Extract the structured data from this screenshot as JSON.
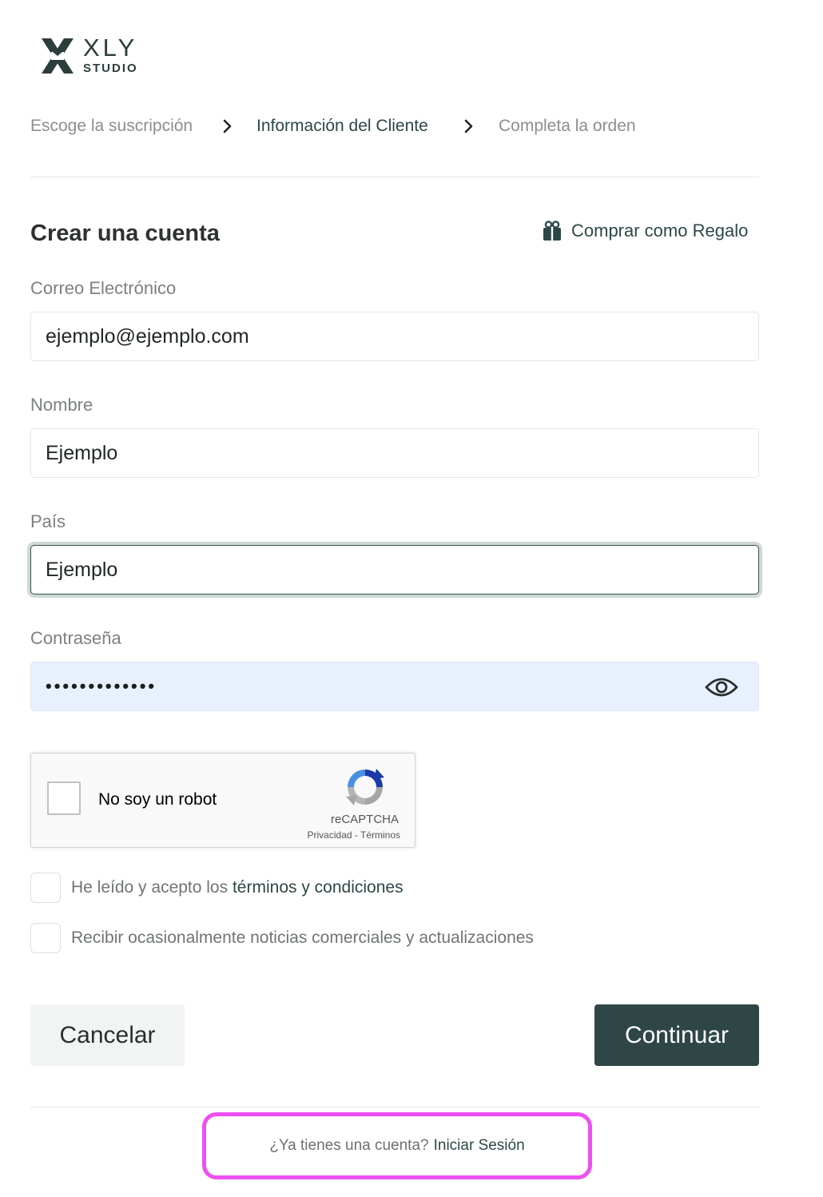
{
  "brand": {
    "name": "XLY",
    "subname": "STUDIO"
  },
  "steps": [
    {
      "label": "Escoge la suscripción"
    },
    {
      "label": "Información del Cliente"
    },
    {
      "label": "Completa la orden"
    }
  ],
  "form": {
    "title": "Crear una cuenta",
    "gift_label": "Comprar como Regalo",
    "fields": {
      "email": {
        "label": "Correo Electrónico",
        "value": "ejemplo@ejemplo.com"
      },
      "name": {
        "label": "Nombre",
        "value": "Ejemplo"
      },
      "country": {
        "label": "País",
        "value": "Ejemplo"
      },
      "password": {
        "label": "Contraseña",
        "value": "•••••••••••••"
      }
    },
    "recaptcha": {
      "label": "No soy un robot",
      "brand": "reCAPTCHA",
      "links": "Privacidad - Términos"
    },
    "checkboxes": {
      "terms_prefix": "He leído y acepto los",
      "terms_link": "términos y condiciones",
      "newsletter": "Recibir ocasionalmente noticias comerciales y actualizaciones"
    },
    "buttons": {
      "cancel": "Cancelar",
      "continue": "Continuar"
    }
  },
  "footer": {
    "question": "¿Ya tienes una cuenta?",
    "login_link": "Iniciar Sesión"
  },
  "colors": {
    "accent": "#2f4646",
    "highlight": "#ee4ff0",
    "autofill": "#e8f0fe"
  }
}
